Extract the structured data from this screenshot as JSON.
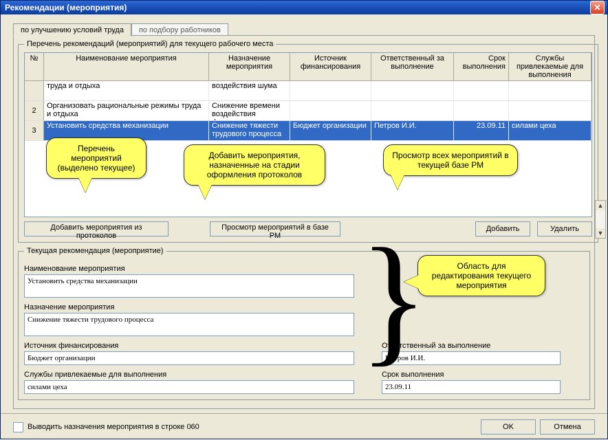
{
  "window": {
    "title": "Рекомендации (мероприятия)"
  },
  "tabs": {
    "active": "по улучшению условий труда",
    "inactive": "по подбору работников"
  },
  "fieldset_list_title": "Перечень рекомендаций (мероприятий) для текущего рабочего места",
  "columns": {
    "n": "№",
    "name": "Наименование мероприятия",
    "nazn": "Назначение мероприятия",
    "ist": "Источник финансирования",
    "otv": "Ответственный за выполнение",
    "srok": "Срок выполнения",
    "sluzh": "Службы привлекаемые для выполнения"
  },
  "rows": [
    {
      "n": "",
      "name": "труда  и отдыха",
      "nazn": "воздействия шума",
      "ist": "",
      "otv": "",
      "srok": "",
      "sluzh": ""
    },
    {
      "n": "2",
      "name": "Организовать рациональные режимы труда  и отдыха",
      "nazn": "Снижение времени воздействия фактора",
      "ist": "",
      "otv": "",
      "srok": "",
      "sluzh": ""
    },
    {
      "n": "3",
      "name": "Установить средства механизации",
      "nazn": "Снижение тяжести трудового процесса",
      "ist": "Бюджет организации",
      "otv": "Петров И.И.",
      "srok": "23.09.11",
      "sluzh": "силами цеха"
    }
  ],
  "buttons": {
    "add_from_protocols": "Добавить мероприятия из протоколов",
    "view_in_db": "Просмотр мероприятий в базе РМ",
    "add": "Добавить",
    "delete": "Удалить",
    "ok": "OK",
    "cancel": "Отмена"
  },
  "fieldset_edit_title": "Текущая рекомендация (мероприятие)",
  "edit": {
    "name_label": "Наименование мероприятия",
    "name_value": "Установить средства механизации",
    "nazn_label": "Назначение мероприятия",
    "nazn_value": "Снижение тяжести трудового процесса",
    "ist_label": "Источник финансирования",
    "ist_value": "Бюджет организации",
    "sluzh_label": "Службы привлекаемые для выполнения",
    "sluzh_value": "силами цеха",
    "otv_label": "Ответственный за выполнение",
    "otv_value": "Петров И.И.",
    "srok_label": "Срок выполнения",
    "srok_value": "23.09.11"
  },
  "callouts": {
    "list": "Перечень мероприятий (выделено текущее)",
    "add_protocols": "Добавить мероприятия, назначенные на стадии оформления протоколов",
    "view_db": "Просмотр всех мероприятий в текущей базе РМ",
    "edit_area": "Область для редактирования текущего мероприятия"
  },
  "footer_checkbox": "Выводить назначения мероприятия в строке 060"
}
